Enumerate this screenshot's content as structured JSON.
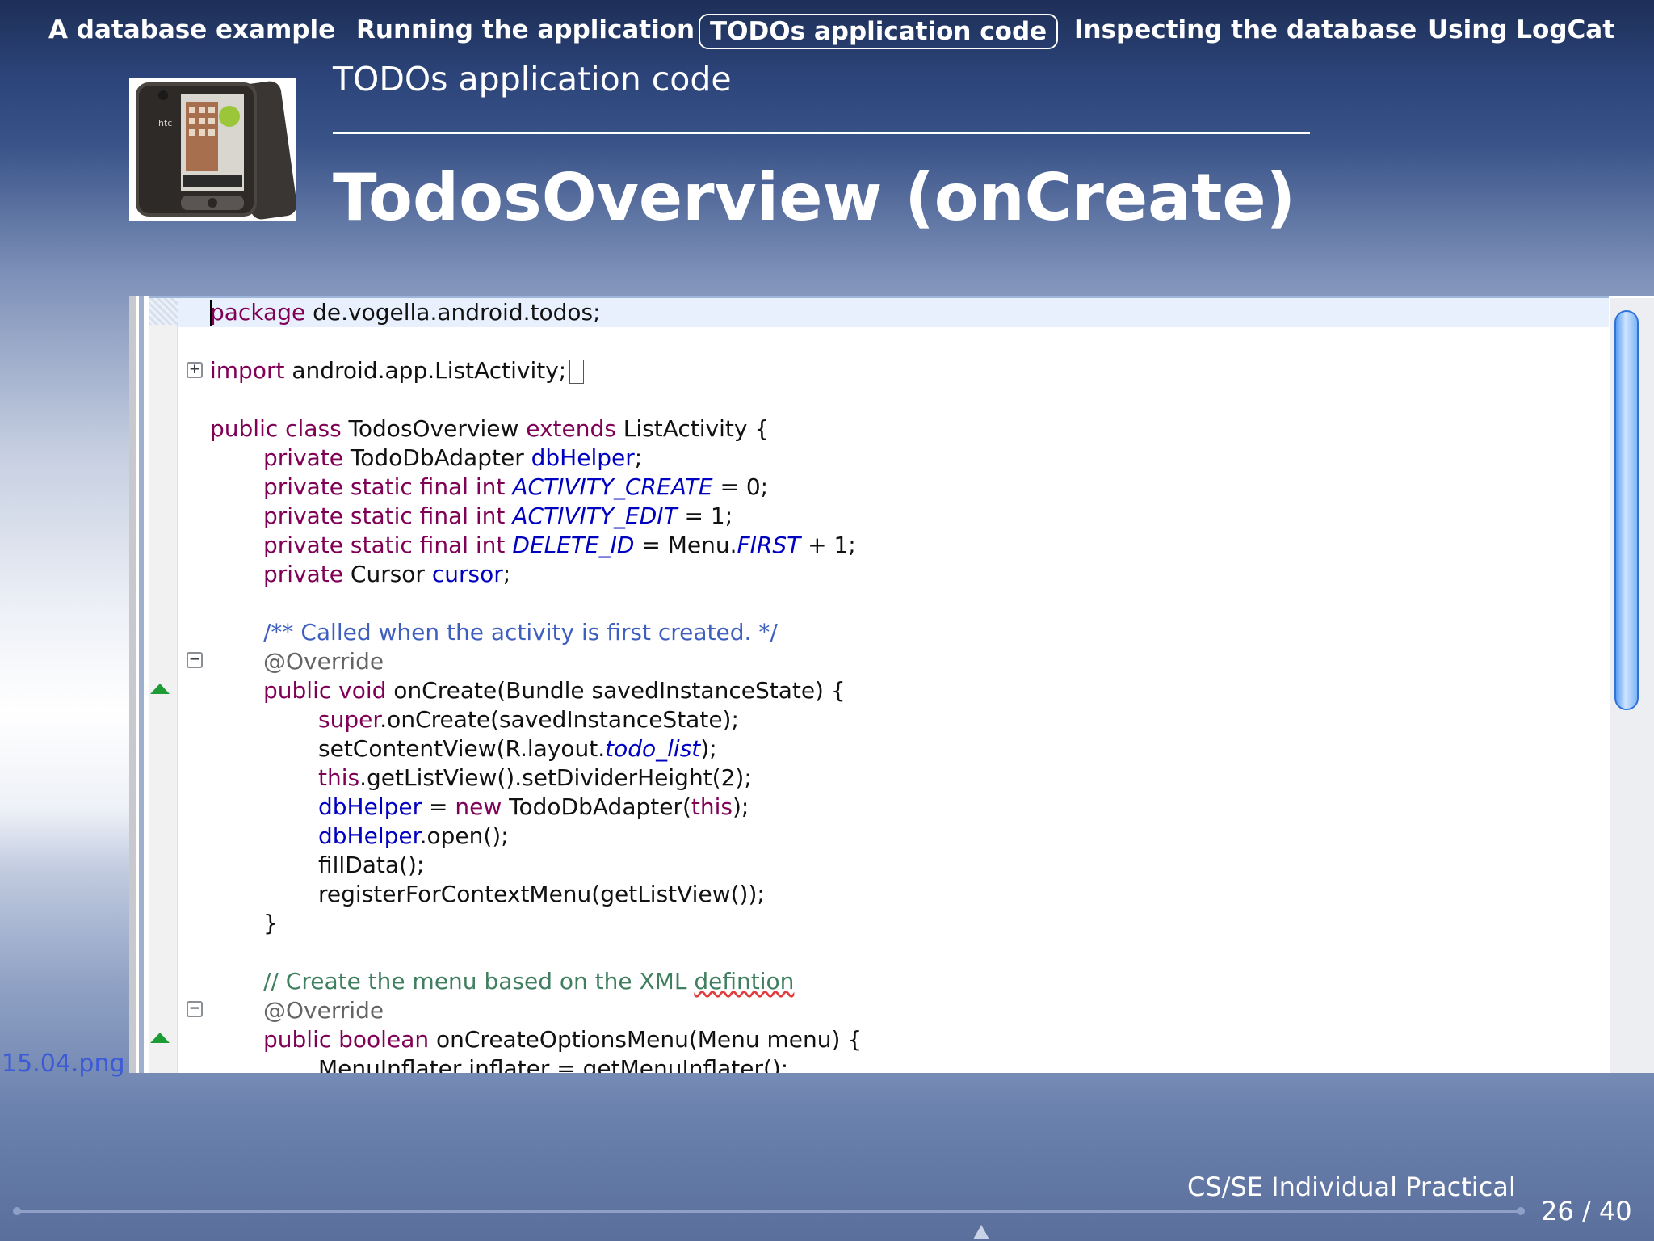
{
  "nav": {
    "items": [
      {
        "label": "A database example"
      },
      {
        "label": "Running the application"
      },
      {
        "label": "TODOs application code"
      },
      {
        "label": "Inspecting the database"
      },
      {
        "label": "Using LogCat"
      }
    ],
    "active_index": 2
  },
  "header": {
    "section_title": "TODOs application code",
    "frame_title": "TodosOverview (onCreate)",
    "image_alt_brand": "htc"
  },
  "code": {
    "l1_kw": "package",
    "l1_rest": " de.vogella.android.todos;",
    "l2_kw": "import",
    "l2_rest": " android.app.ListActivity;",
    "l3_kw": "public class",
    "l3_mid": " TodosOverview ",
    "l3_kw2": "extends",
    "l3_rest": " ListActivity {",
    "l4_kw": "private",
    "l4_mid": " TodoDbAdapter ",
    "l4_fld": "dbHelper",
    "l4_end": ";",
    "l5_kw": "private static final int",
    "l5_cst": "ACTIVITY_CREATE",
    "l5_end": " = 0;",
    "l6_kw": "private static final int",
    "l6_cst": "ACTIVITY_EDIT",
    "l6_end": " = 1;",
    "l7_kw": "private static final int",
    "l7_cst": "DELETE_ID",
    "l7_mid": " = Menu.",
    "l7_cst2": "FIRST",
    "l7_end": " + 1;",
    "l8_kw": "private",
    "l8_mid": " Cursor ",
    "l8_fld": "cursor",
    "l8_end": ";",
    "l9_cmt": "/** Called when the activity is first created. */",
    "l10_ann": "@Override",
    "l11_kw": "public void",
    "l11_rest": " onCreate(Bundle savedInstanceState) {",
    "l12_kw": "super",
    "l12_rest": ".onCreate(savedInstanceState);",
    "l13_pre": "setContentView(R.layout.",
    "l13_cst": "todo_list",
    "l13_end": ");",
    "l14_kw": "this",
    "l14_rest": ".getListView().setDividerHeight(2);",
    "l15_fld": "dbHelper",
    "l15_mid": " = ",
    "l15_kw": "new",
    "l15_mid2": " TodoDbAdapter(",
    "l15_kw2": "this",
    "l15_end": ");",
    "l16_fld": "dbHelper",
    "l16_rest": ".open();",
    "l17": "fillData();",
    "l18": "registerForContextMenu(getListView());",
    "l19": "}",
    "l20_cmt": "// Create the menu based on the XML ",
    "l20_sq": "defintion",
    "l21_ann": "@Override",
    "l22_kw": "public boolean",
    "l22_rest": " onCreateOptionsMenu(Menu menu) {",
    "l23": "MenuInflater inflater = getMenuInflater();"
  },
  "file_label": "15.04.png",
  "footer": {
    "course": "CS/SE Individual Practical",
    "page": "26 / 40"
  }
}
